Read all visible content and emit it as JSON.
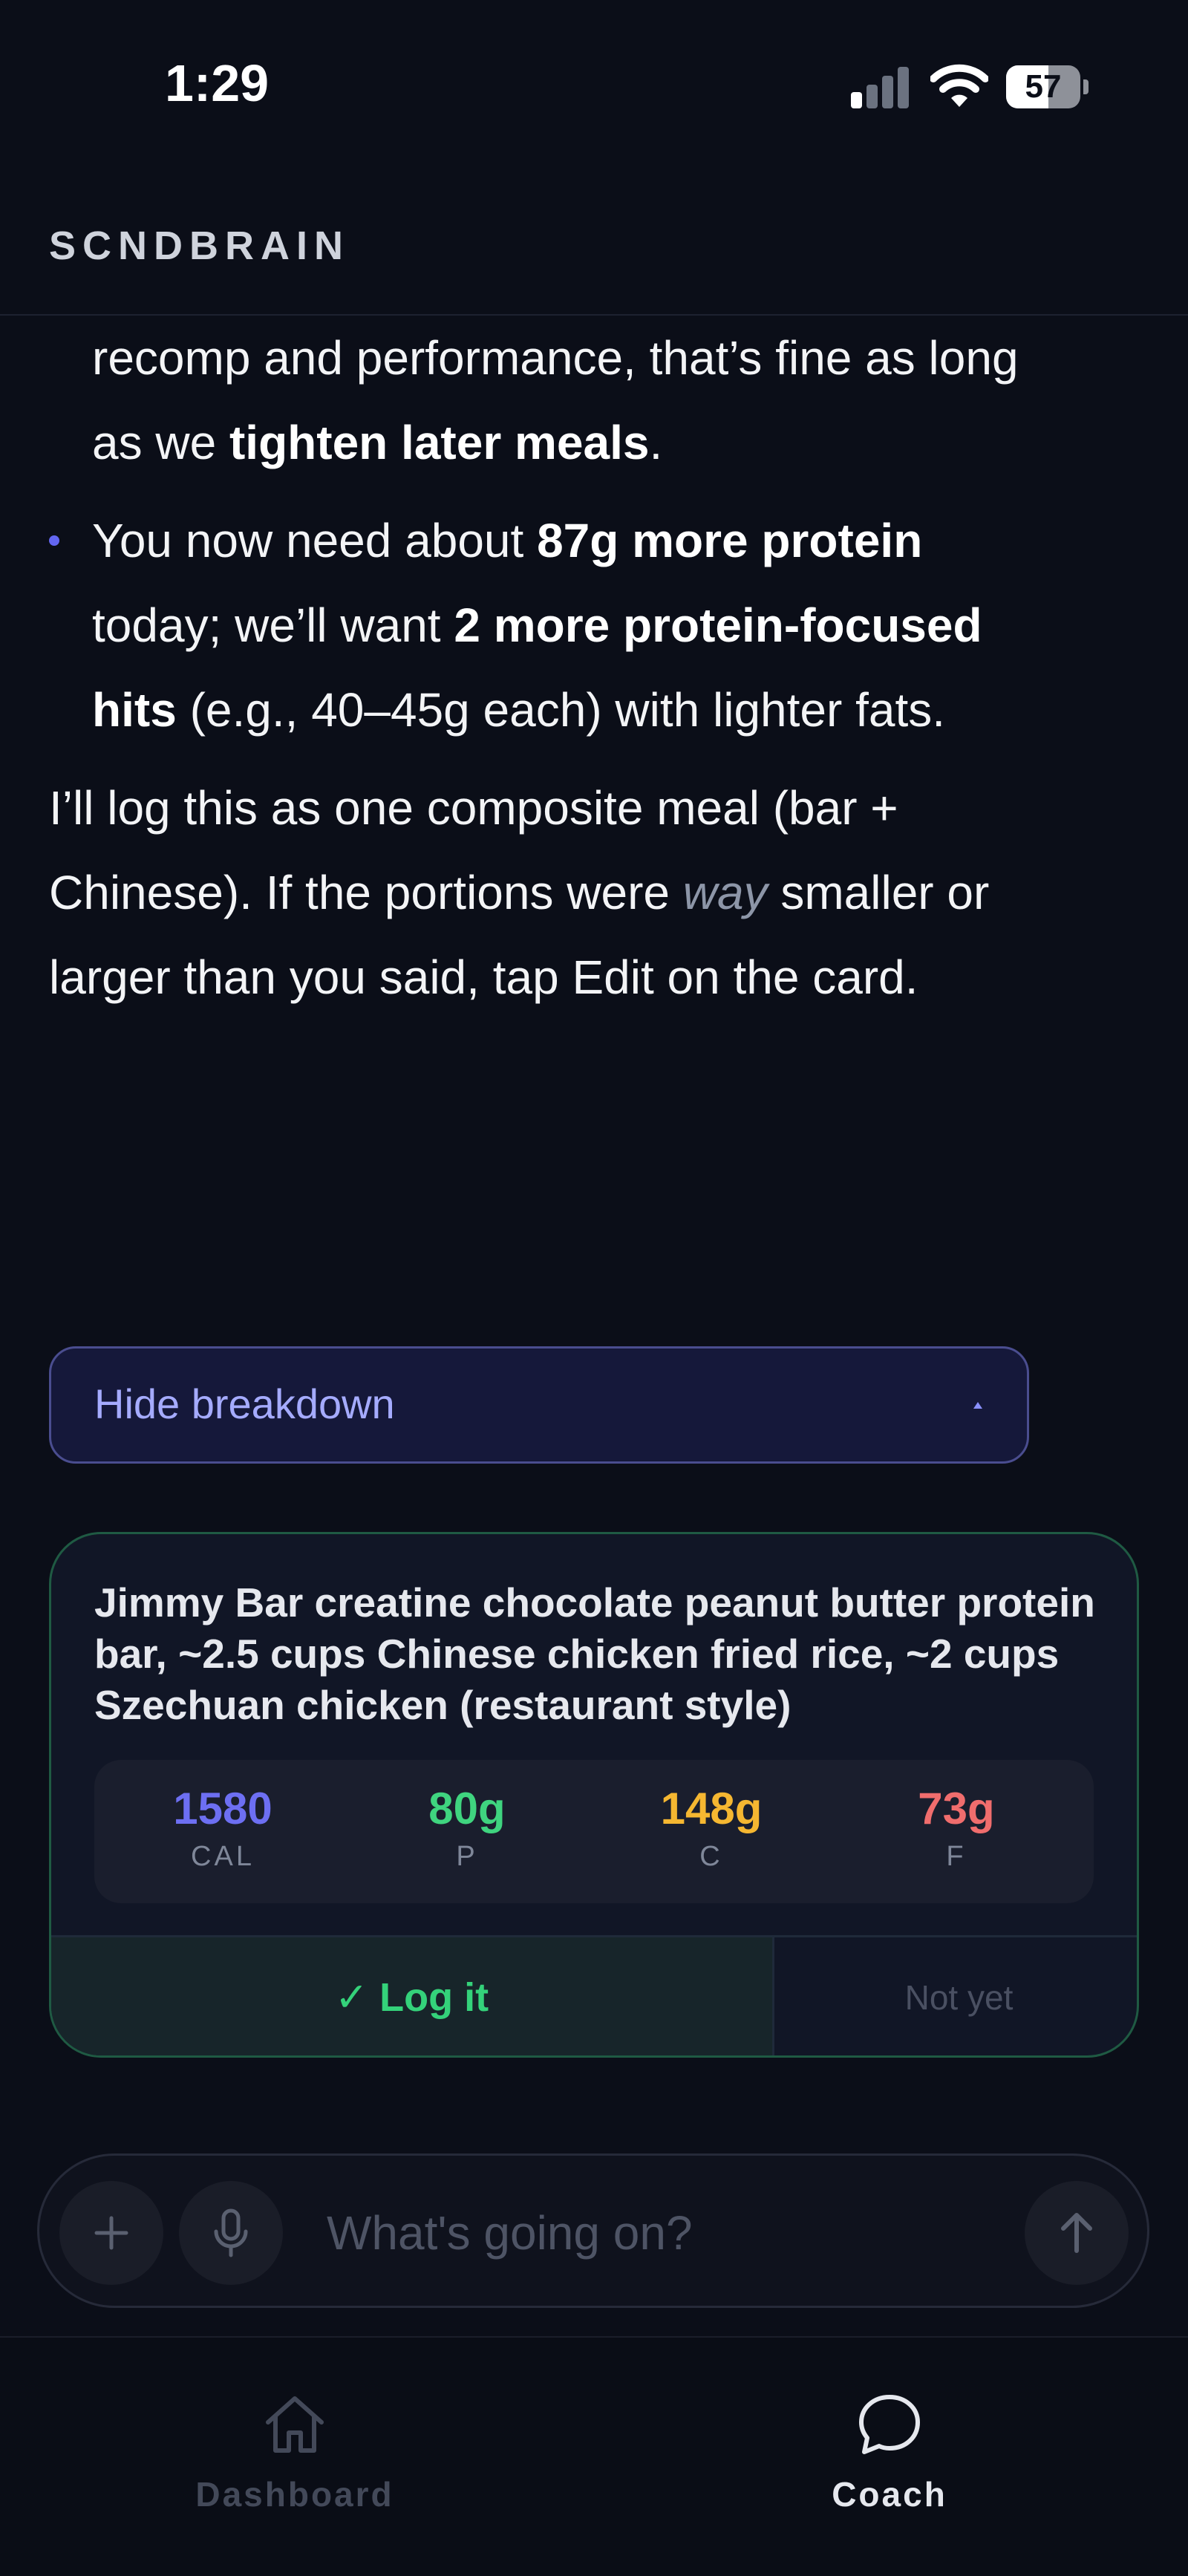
{
  "status_bar": {
    "time": "1:29",
    "battery": "57",
    "battery_level": 0.57
  },
  "header": {
    "brand": "SCNDBRAIN"
  },
  "message": {
    "p1_pre": "recomp and performance, that’s fine as long as we ",
    "p1_bold": "tighten later meals",
    "p1_post": ".",
    "p2_pre": "You now need about ",
    "p2_bold1": "87g more protein",
    "p2_mid": " today; we’ll want ",
    "p2_bold2": "2 more protein-focused hits",
    "p2_post": " (e.g., 40–45g each) with lighter fats.",
    "p3_pre": "I’ll log this as one composite meal (bar + Chinese). If the portions were ",
    "p3_em": "way",
    "p3_post": " smaller or larger than you said, tap Edit on the card."
  },
  "breakdown": {
    "label": "Hide breakdown"
  },
  "meal_card": {
    "description": "Jimmy Bar creatine chocolate peanut butter protein bar, ~2.5 cups Chinese chicken fried rice, ~2 cups Szechuan chicken (restaurant style)",
    "macros": [
      {
        "value": "1580",
        "label": "CAL",
        "color": "#6d6ff2"
      },
      {
        "value": "80g",
        "label": "P",
        "color": "#3fd47f"
      },
      {
        "value": "148g",
        "label": "C",
        "color": "#f5b731"
      },
      {
        "value": "73g",
        "label": "F",
        "color": "#f06d6d"
      }
    ],
    "log_label": "✓ Log it",
    "not_yet_label": "Not yet"
  },
  "composer": {
    "placeholder": "What's going on?"
  },
  "tabs": [
    {
      "label": "Dashboard",
      "icon": "home-icon",
      "active": false
    },
    {
      "label": "Coach",
      "icon": "chat-bubble-icon",
      "active": true
    }
  ]
}
